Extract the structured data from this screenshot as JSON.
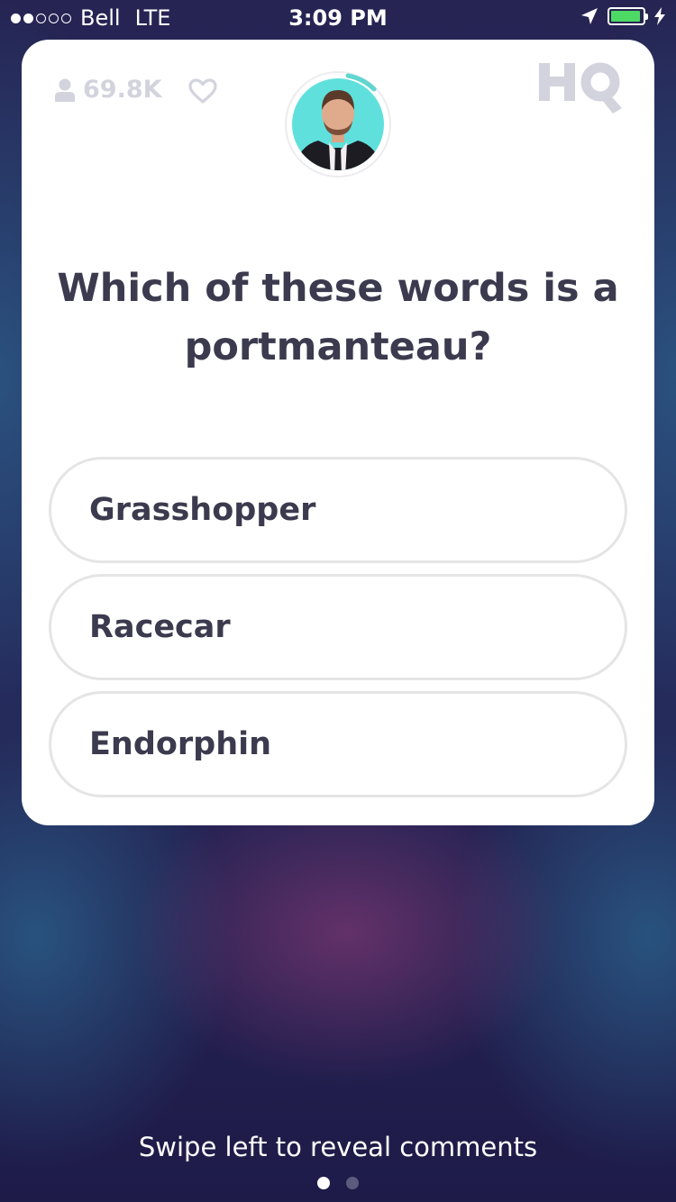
{
  "status_bar": {
    "carrier": "Bell",
    "network": "LTE",
    "time": "3:09 PM",
    "signal_bars_filled": 2,
    "signal_bars_total": 5,
    "battery_level": 0.95,
    "battery_color": "#4cd964",
    "icons": [
      "location-arrow-icon",
      "battery-icon",
      "charging-bolt-icon"
    ]
  },
  "header": {
    "viewer_count": "69.8K",
    "viewer_icon": "person-icon",
    "like_icon": "heart-icon",
    "logo": "HQ",
    "timer_color": "#5fd6cf"
  },
  "question": {
    "text": "Which of these words is a portmanteau?"
  },
  "answers": [
    {
      "label": "Grasshopper"
    },
    {
      "label": "Racecar"
    },
    {
      "label": "Endorphin"
    }
  ],
  "footer": {
    "hint": "Swipe left to reveal comments",
    "page_count": 2,
    "active_page": 1
  },
  "colors": {
    "text_dark": "#3b3a4e",
    "muted": "#d3d3de",
    "answer_border": "#e5e5e5",
    "background": "#25285a"
  }
}
